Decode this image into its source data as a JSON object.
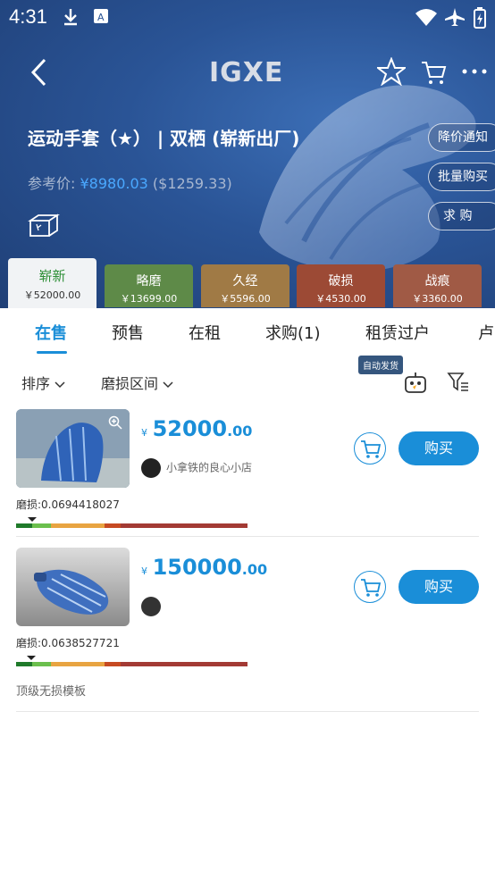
{
  "status_bar": {
    "time": "4:31"
  },
  "header": {
    "logo": "IGXE",
    "title": "运动手套（★） | 双栖 (崭新出厂)",
    "ref_label": "参考价: ",
    "ref_cny": "¥8980.03",
    "ref_usd": "($1259.33)"
  },
  "side_buttons": {
    "price_alert": "降价通知",
    "bulk_buy": "批量购买",
    "want_buy": "求  购"
  },
  "wear_tabs": [
    {
      "name": "崭新",
      "price": "￥52000.00",
      "color": "#f1f3f5"
    },
    {
      "name": "略磨",
      "price": "￥13699.00",
      "color": "#5e8a48"
    },
    {
      "name": "久经",
      "price": "￥5596.00",
      "color": "#a07a45"
    },
    {
      "name": "破损",
      "price": "￥4530.00",
      "color": "#9c4a35"
    },
    {
      "name": "战痕",
      "price": "￥3360.00",
      "color": "#a05a45"
    }
  ],
  "tabs": [
    "在售",
    "预售",
    "在租",
    "求购(1)",
    "租赁过户",
    "卢"
  ],
  "filters": {
    "sort": "排序",
    "wear_range": "磨损区间",
    "auto_badge": "自动发货"
  },
  "listings": [
    {
      "yen": "¥",
      "price_int": "52000",
      "price_dec": ".00",
      "seller": "小拿铁的良心小店",
      "wear": "磨损:0.0694418027",
      "wear_fraction": 0.0694418027,
      "buy_label": "购买",
      "note": ""
    },
    {
      "yen": "¥",
      "price_int": "150000",
      "price_dec": ".00",
      "seller": "",
      "wear": "磨损:0.0638527721",
      "wear_fraction": 0.0638527721,
      "buy_label": "购买",
      "note": "顶级无损模板"
    }
  ],
  "colors": {
    "accent": "#1a8ed8",
    "header_bg": "#2a5496"
  }
}
